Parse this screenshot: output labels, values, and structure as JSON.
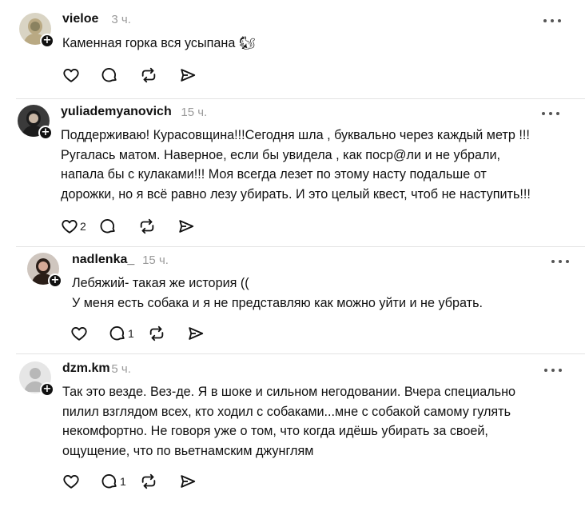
{
  "posts": [
    {
      "username": "vieloe",
      "time": "3 ч.",
      "lines": [
        "Каменная горка вся усыпана 🐿"
      ],
      "likes": "",
      "replies": ""
    },
    {
      "username": "yuliademyanovich",
      "time": "15 ч.",
      "lines": [
        "Поддерживаю! Курасовщина!!!Сегодня шла , буквально через каждый метр !!!",
        "Ругалась матом. Наверное, если бы увидела , как поср@ли и не убрали,",
        "напала бы с кулаками!!! Моя всегда лезет по этому насту подальше от",
        "дорожки, но я всё равно лезу убирать. И это целый квест, чтоб не наступить!!!"
      ],
      "likes": "2",
      "replies": ""
    },
    {
      "username": "nadlenka_",
      "time": "15 ч.",
      "lines": [
        "Лебяжий- такая же история ((",
        "У меня есть собака и я не представляю как можно уйти и не убрать."
      ],
      "likes": "",
      "replies": "1"
    },
    {
      "username": "dzm.km",
      "time": "5 ч.",
      "lines": [
        "Так это везде. Вез-де. Я в шоке и сильном негодовании. Вчера специально",
        "пилил взглядом всех, кто ходил с собаками...мне с собакой самому гулять",
        "некомфортно. Не говоря уже о том, что когда идёшь убирать за своей,",
        "ощущение, что по вьетнамским джунглям"
      ],
      "likes": "",
      "replies": "1"
    }
  ],
  "icons": {
    "like": "heart-icon",
    "reply": "comment-icon",
    "repost": "repost-icon",
    "share": "share-icon",
    "more": "more-icon",
    "follow": "plus-icon"
  }
}
